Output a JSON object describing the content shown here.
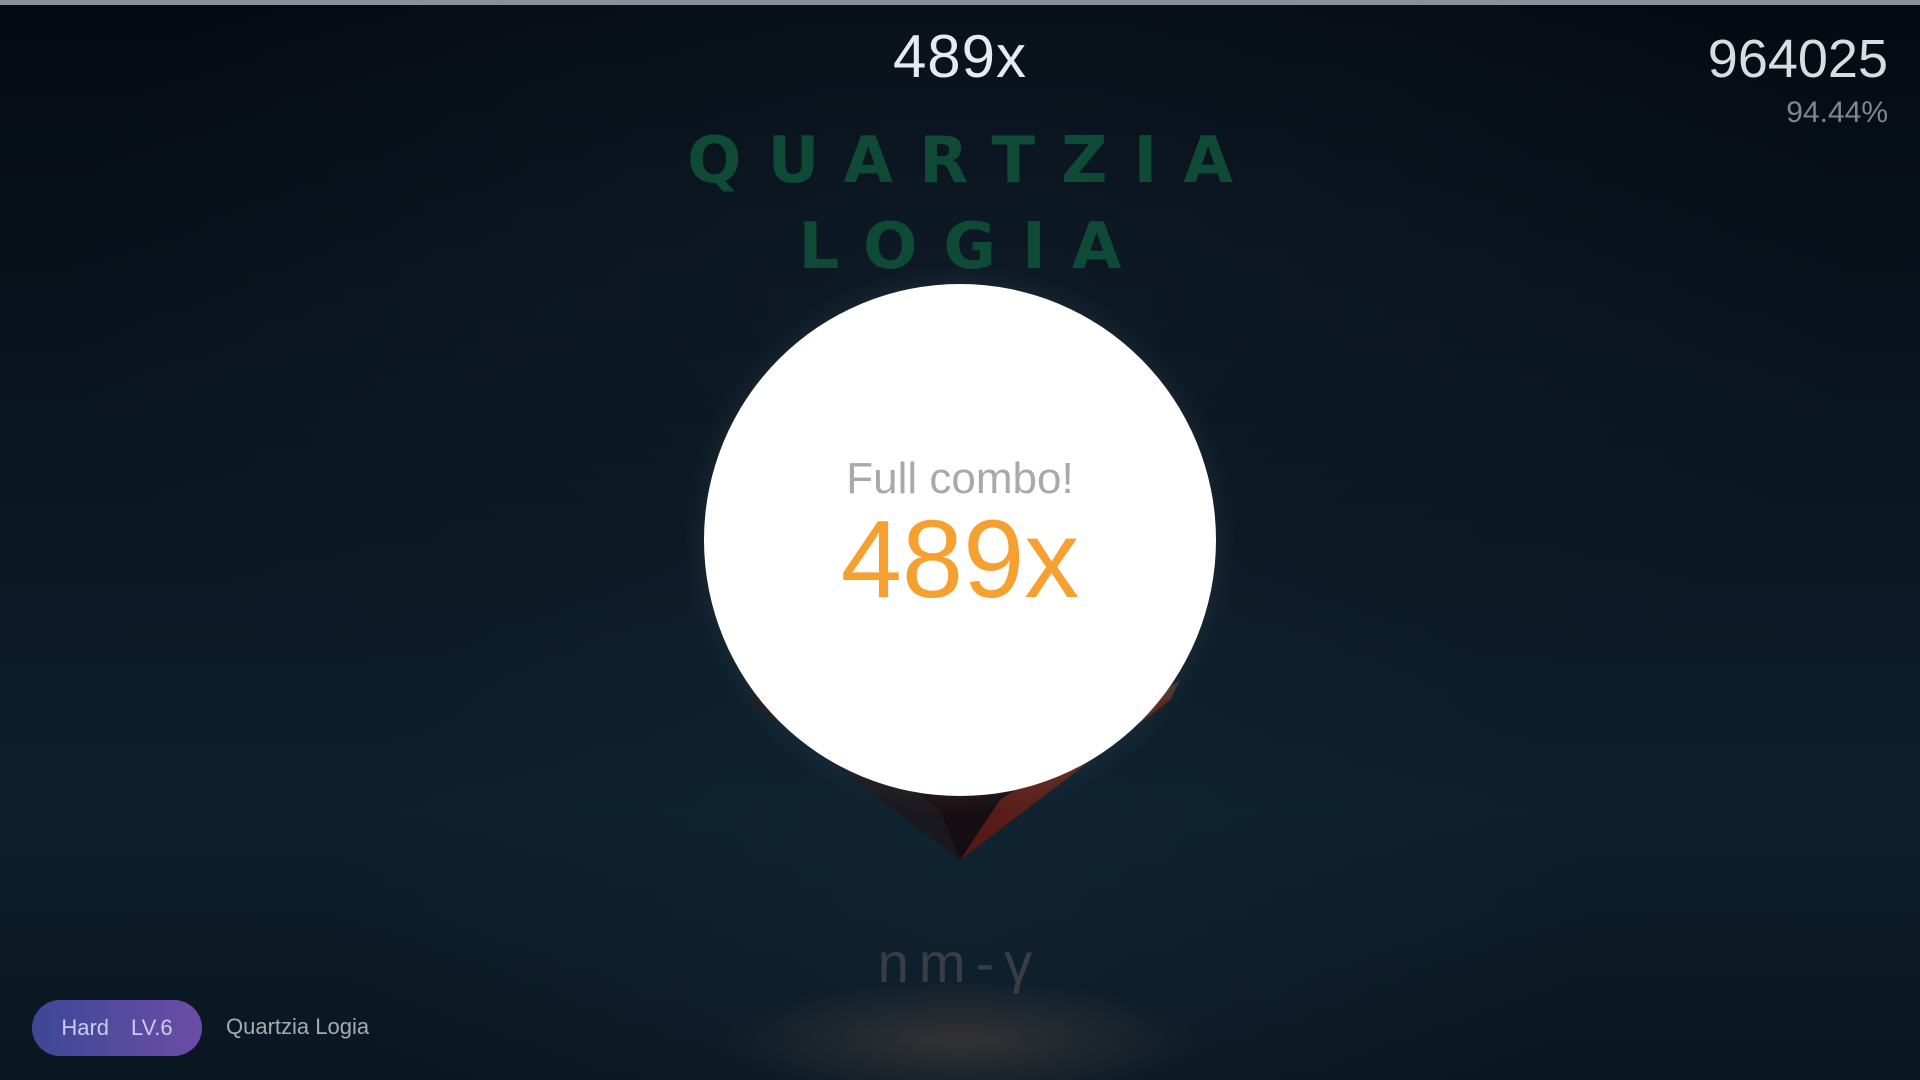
{
  "hud": {
    "combo": "489x",
    "score": "964025",
    "accuracy": "94.44%"
  },
  "background_art": {
    "title_line1": "QUARTZIA",
    "title_line2": "LOGIA",
    "artist": "nm-γ"
  },
  "result": {
    "label": "Full combo!",
    "combo": "489x"
  },
  "footer": {
    "difficulty": "Hard",
    "level": "LV.6",
    "song_name": "Quartzia Logia"
  },
  "colors": {
    "accent_orange": "#f7a032",
    "pill_blue": "#3d4796",
    "pill_purple": "#6b4da6",
    "title_green": "#0e4a35"
  }
}
